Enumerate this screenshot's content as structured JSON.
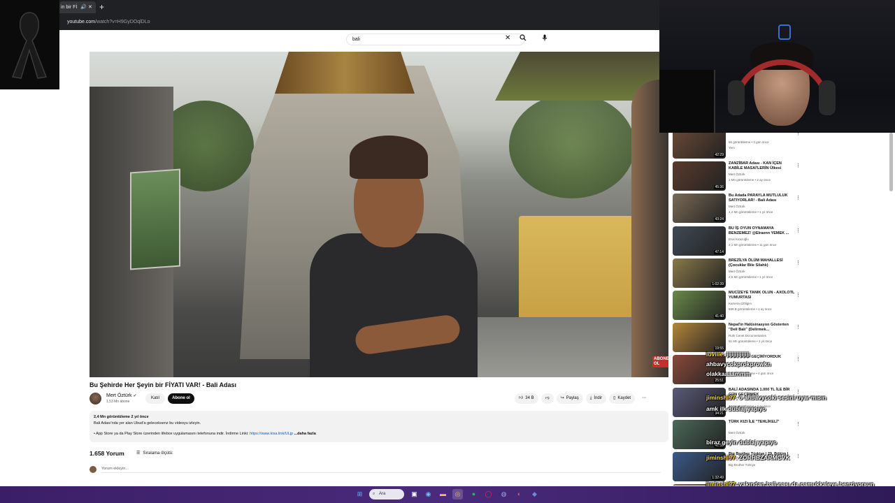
{
  "browser": {
    "tab_title": "in bir Fİ",
    "url_host": "youtube.com",
    "url_path": "/watch?v=H9GyDOqlDLo"
  },
  "search": {
    "query": "bali"
  },
  "video": {
    "title": "Bu Şehirde Her Şeyin bir FİYATI VAR! - Bali Adası",
    "channel": "Mert Öztürk",
    "subscribers": "1,53 Mn abone",
    "join_label": "Katıl",
    "subscribe_label": "Abone ol",
    "likes": "34 B",
    "share_label": "Paylaş",
    "download_label": "İndir",
    "save_label": "Kaydet",
    "views_date": "2,4 Mn görüntüleme  2 yıl önce",
    "desc_line1": "Bali Adası'nda yer alan Ubud'a geleceksenz bu videoyu izleyin.",
    "desc_line2": "• App Store ya da Play Store üzerinden lifebox uygulamasını telefonuna indir. İndirme Linki:",
    "desc_link": "https://www.kisa.link/ULjp",
    "desc_more": "...daha fazla",
    "comments_count": "1.658 Yorum",
    "sort_label": "Sıralama ölçütü:",
    "comment_placeholder": "Yorum ekleyin..."
  },
  "recommendations": [
    {
      "title": "",
      "channel": "65 görüntüleme • 3 gün önce",
      "views": "Yeni",
      "duration": "42:29"
    },
    {
      "title": "ZANZİBAR Adası - KAN İÇEN KABİLE MASAİ'LERİN Ülkesi",
      "channel": "Mert Öztürk",
      "views": "1 Mn görüntüleme • 2 ay önce",
      "duration": "45:36"
    },
    {
      "title": "Bu Adada PARAYLA MUTLULUK SATIYORLAR! - Bali Adası",
      "channel": "Mert Öztürk",
      "views": "1,2 Mn görüntüleme • 1 yıl önce",
      "duration": "43:24"
    },
    {
      "title": "BU İŞ OYUN OYNAMAYA BENZEMEZ! @Elraenn YEMEK ...",
      "channel": "Enis Kirazoğlu",
      "views": "2,1 Mn görüntüleme • 11 gün önce",
      "duration": "47:14"
    },
    {
      "title": "BREZİLYA ÖLÜM MAHALLESİ (Çocuklar Bile Silahlı)",
      "channel": "Mert Öztürk",
      "views": "2,6 Mn görüntüleme • 1 yıl önce",
      "duration": "1:02:39"
    },
    {
      "title": "MUCİZEYE TANIK OLUN - AXOLOTL YUMURTASI",
      "channel": "Kamera Ciftligim",
      "views": "589 B görüntüleme • 1 ay önce",
      "duration": "41:40"
    },
    {
      "title": "Nepal'in Halüsinasyon Gösterten \"Deli Balı\" (Delirmek...",
      "channel": "Ruhi Cenet Documentaries",
      "views": "91 Mn görüntüleme • 1 yıl önce",
      "duration": "19:55"
    },
    {
      "title": "KALP KRİZİ GEÇİRİYORDUK",
      "channel": "",
      "views": "131 B görüntüleme • 4 gün önce",
      "duration": "25:51"
    },
    {
      "title": "BALİ ADASINDA 1.000 TL İLE BİR GÜN GEÇİRMEK",
      "channel": "",
      "views": "1 Mn görüntüleme • 2 ay önce",
      "duration": "34:21"
    },
    {
      "title": "TÜRK KIZI İLE \"TEHLİKELİ\"",
      "channel": "Mert Öztürk",
      "views": "",
      "duration": "41:55"
    },
    {
      "title": "Big Brother Türkiye | 29. Bölüm |",
      "channel": "Big Brother Türkiye",
      "views": "",
      "duration": "1:32:49"
    },
    {
      "title": "BALİ'DE 1 MİLYON RUPİLE",
      "channel": "",
      "views": "",
      "duration": ""
    }
  ],
  "chat": [
    {
      "user": "luviiie",
      "msg": ": jijijijijijiji"
    },
    {
      "user": "",
      "msg": "ahbavycokprokprowkn"
    },
    {
      "user": "",
      "msg": "olakkaaaammm"
    },
    {
      "user": "jiminshi97",
      "msg": ": ö ahbavycoki sesini uyar mısın"
    },
    {
      "user": "",
      "msg": "amk ilk dublaj yapıyo"
    },
    {
      "user": "",
      "msg": "biraz geyin dublaj yapıyo"
    },
    {
      "user": "jiminshi97",
      "msg": ": ZORHBZARMCVK"
    },
    {
      "user": "jiminshi97",
      "msg": ": yakından bali nası da pamukkaleye benziyorsun"
    },
    {
      "user": "luviiie",
      "msg": ": şu kutsal suya bi giremedik"
    }
  ],
  "taskbar": {
    "search_label": "Ara"
  },
  "colors": {
    "subscribe": "#0f0f0f",
    "link": "#065fd4",
    "taskbar": "#4a2a7c",
    "chat_user": "#ffd940"
  }
}
